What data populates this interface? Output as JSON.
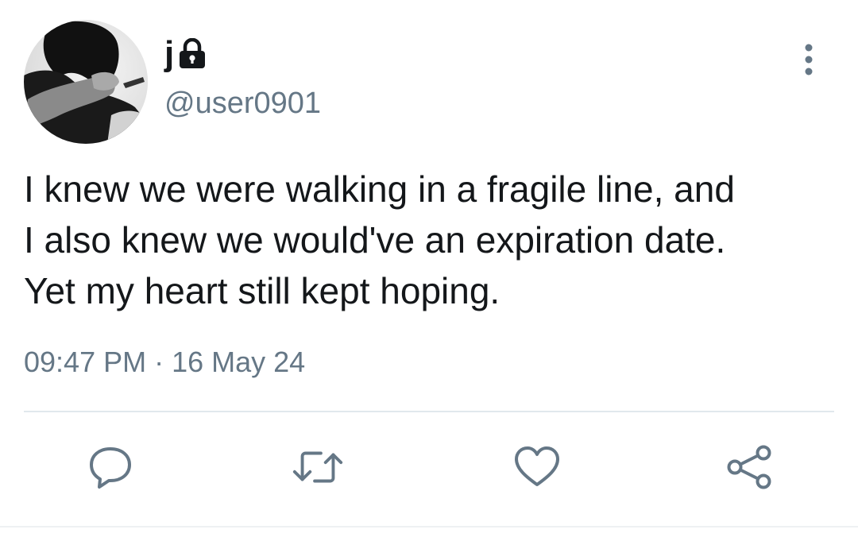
{
  "tweet": {
    "display_name": "j",
    "handle": "@user0901",
    "text": "I knew we were walking in a fragile line, and\nI also knew we would've an expiration date.\nYet my heart still kept hoping.",
    "time": "09:47 PM",
    "separator": " · ",
    "date": "16 May 24"
  },
  "icons": {
    "protected": "lock-icon",
    "more": "vertical-ellipsis-icon",
    "reply": "comment-bubble-icon",
    "retweet": "retweet-icon",
    "like": "heart-icon",
    "share": "share-icon"
  },
  "colors": {
    "text": "#14171a",
    "secondary": "#657786",
    "divider": "#e1e8ed"
  }
}
